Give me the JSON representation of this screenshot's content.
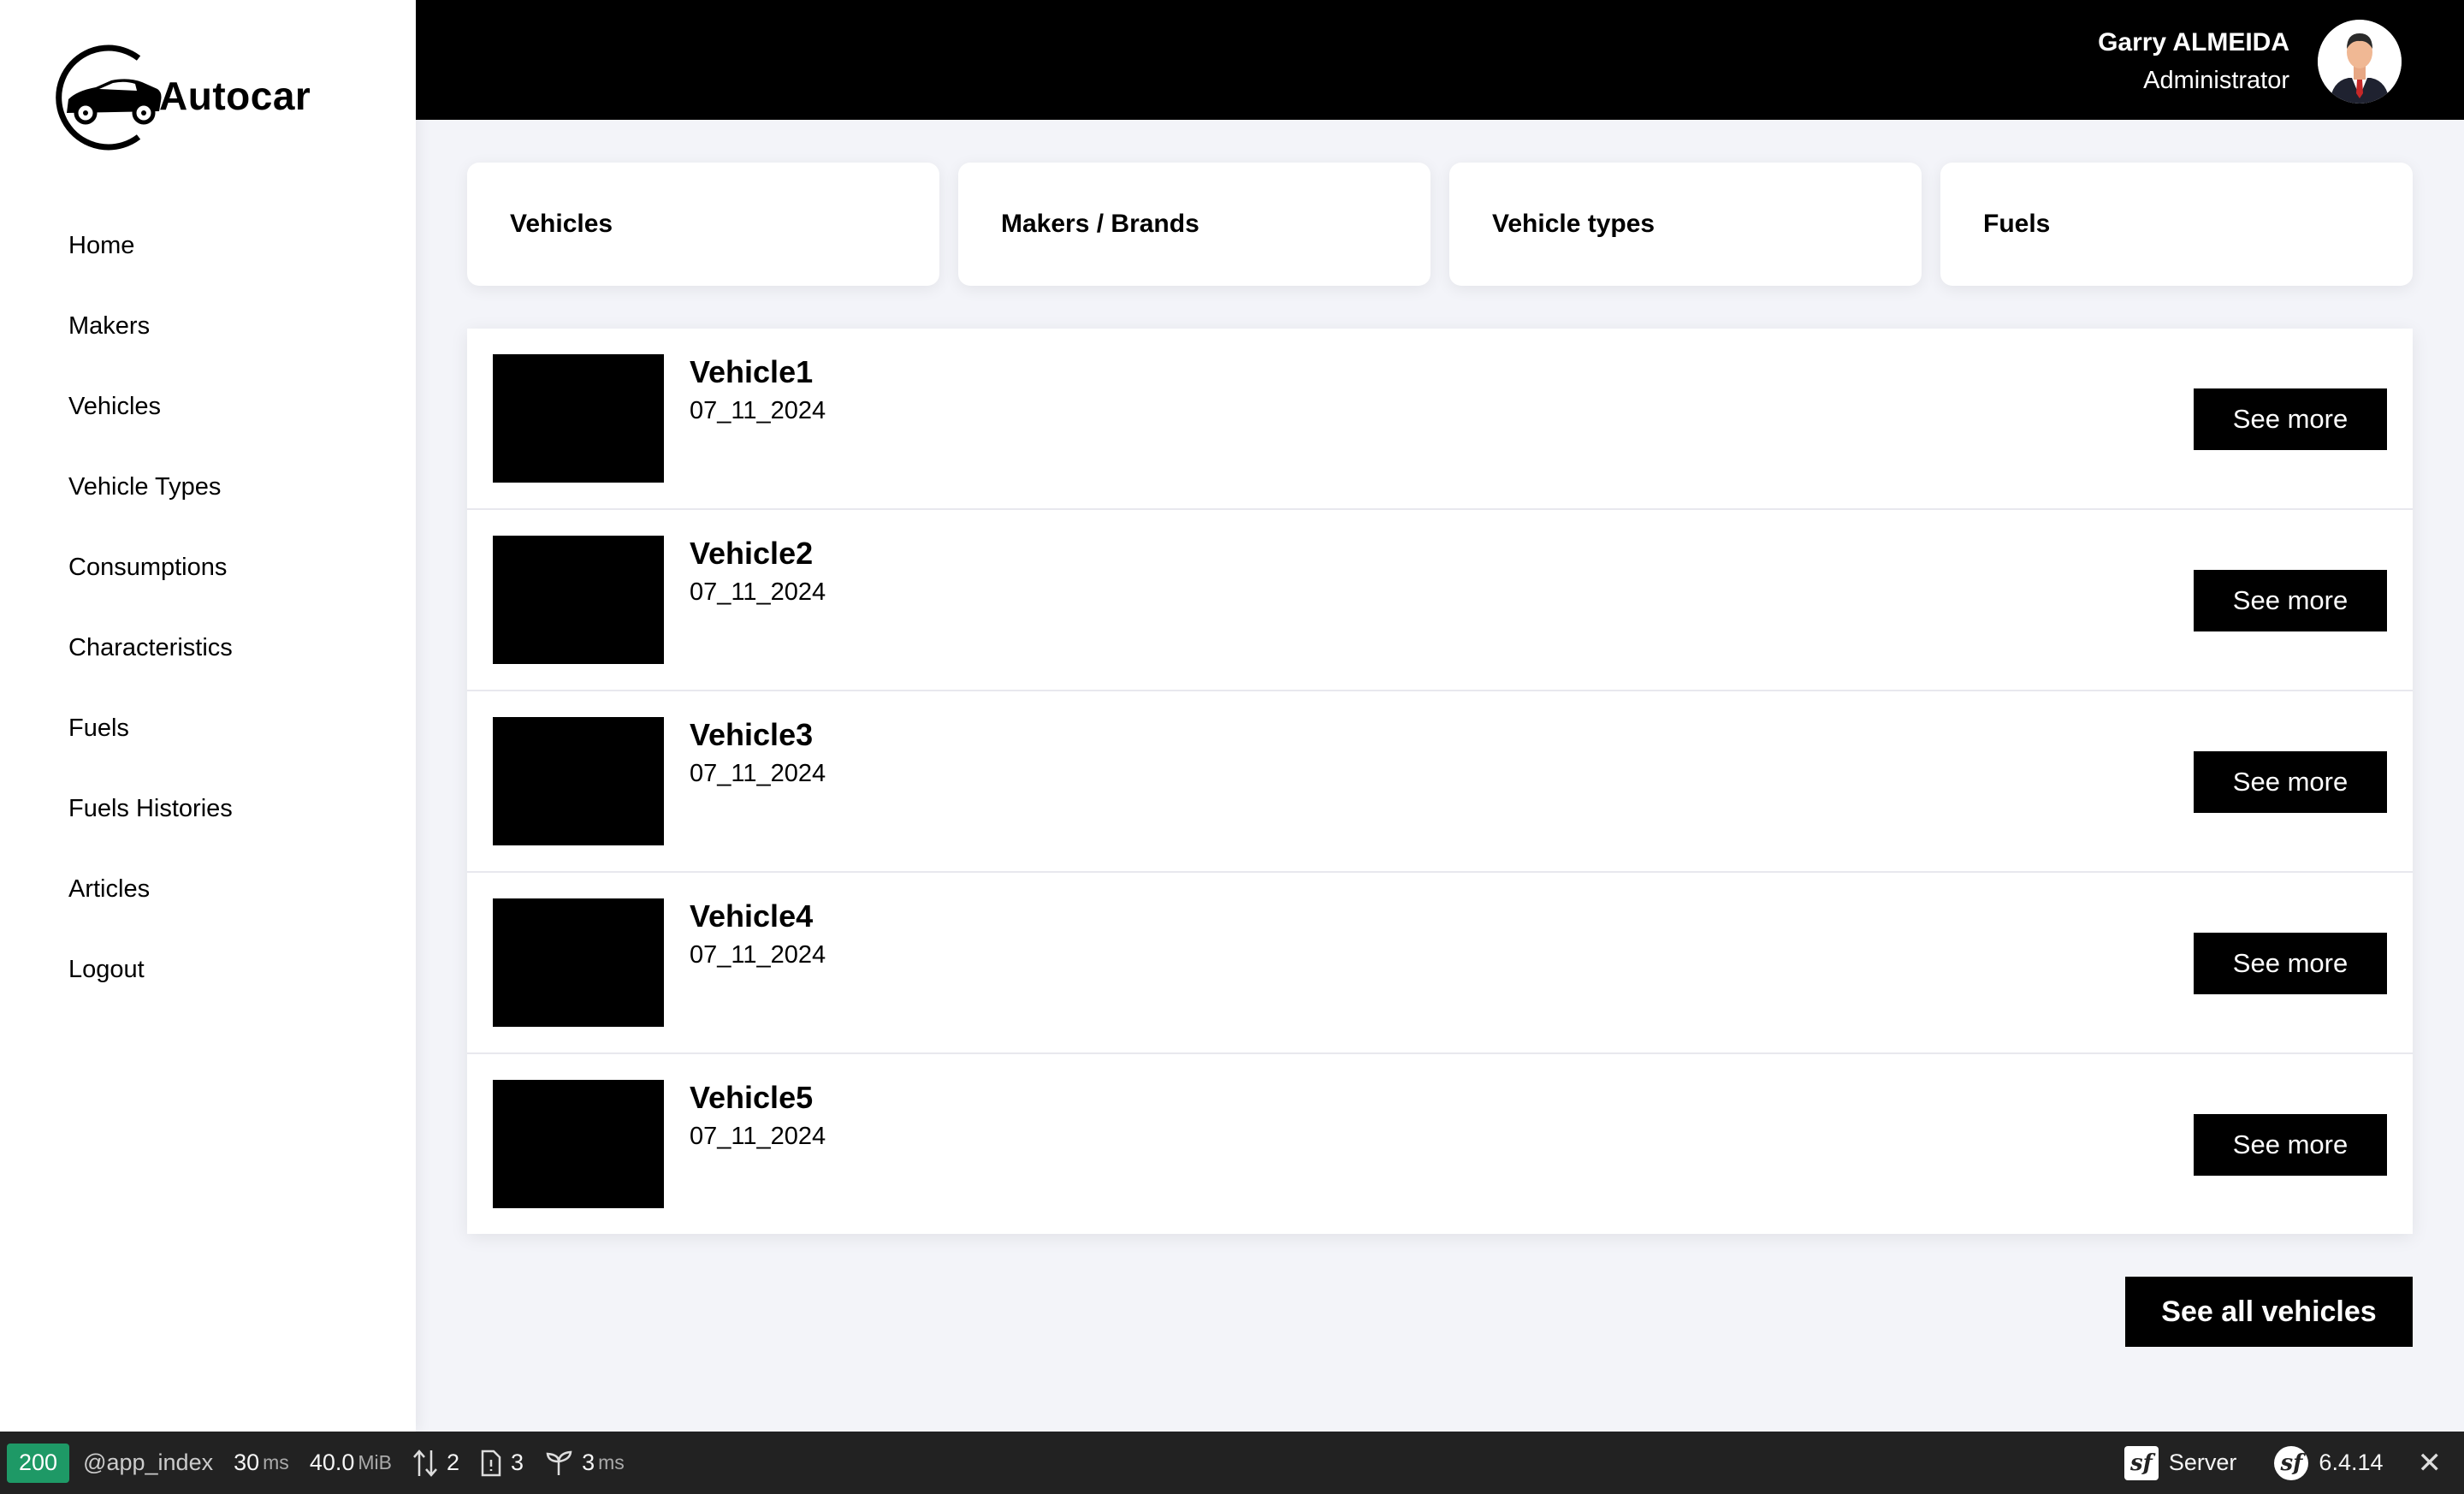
{
  "brand": {
    "name": "Autocar"
  },
  "sidebar": {
    "items": [
      {
        "label": "Home"
      },
      {
        "label": "Makers"
      },
      {
        "label": "Vehicles"
      },
      {
        "label": "Vehicle Types"
      },
      {
        "label": "Consumptions"
      },
      {
        "label": "Characteristics"
      },
      {
        "label": "Fuels"
      },
      {
        "label": "Fuels Histories"
      },
      {
        "label": "Articles"
      },
      {
        "label": "Logout"
      }
    ]
  },
  "header": {
    "user_name": "Garry ALMEIDA",
    "user_role": "Administrator"
  },
  "tiles": [
    {
      "label": "Vehicles"
    },
    {
      "label": "Makers / Brands"
    },
    {
      "label": "Vehicle types"
    },
    {
      "label": "Fuels"
    }
  ],
  "vehicles": [
    {
      "name": "Vehicle1",
      "date": "07_11_2024",
      "button": "See more"
    },
    {
      "name": "Vehicle2",
      "date": "07_11_2024",
      "button": "See more"
    },
    {
      "name": "Vehicle3",
      "date": "07_11_2024",
      "button": "See more"
    },
    {
      "name": "Vehicle4",
      "date": "07_11_2024",
      "button": "See more"
    },
    {
      "name": "Vehicle5",
      "date": "07_11_2024",
      "button": "See more"
    }
  ],
  "see_all_label": "See all vehicles",
  "debug_toolbar": {
    "status_code": "200",
    "route": "@app_index",
    "time_value": "30",
    "time_unit": "ms",
    "memory_value": "40.0",
    "memory_unit": "MiB",
    "requests": "2",
    "logs": "3",
    "twig_value": "3",
    "twig_unit": "ms",
    "server_label": "Server",
    "version": "6.4.14"
  },
  "colors": {
    "accent": "#000000",
    "background": "#f3f4f9",
    "status_ok": "#1e9966",
    "toolbar_bg": "#222222"
  }
}
